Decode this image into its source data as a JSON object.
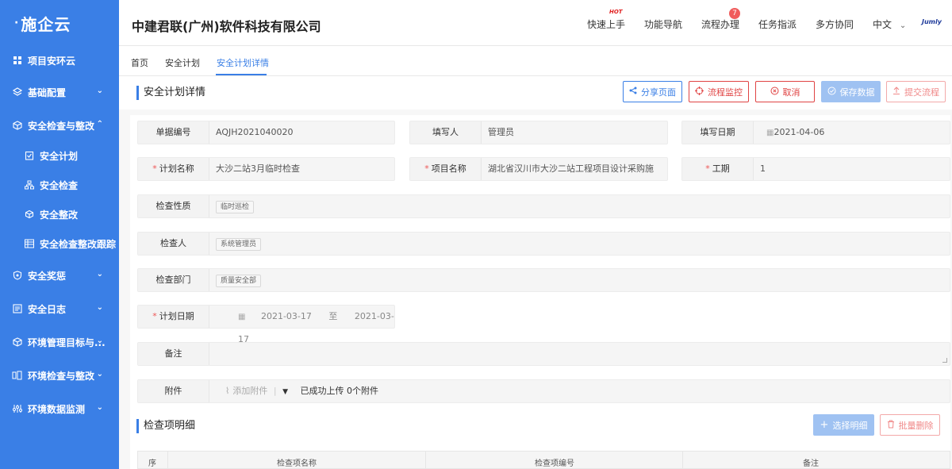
{
  "app": {
    "logo": "施企云"
  },
  "sidebar": {
    "items": [
      {
        "label": "项目安环云",
        "icon": "grid-icon"
      },
      {
        "label": "基础配置",
        "icon": "layers-icon"
      },
      {
        "label": "安全检查与整改",
        "icon": "cube-icon"
      },
      {
        "label": "安全计划",
        "icon": "clipboard-check-icon"
      },
      {
        "label": "安全检查",
        "icon": "sitemap-icon"
      },
      {
        "label": "安全整改",
        "icon": "cube-small-icon"
      },
      {
        "label": "安全检查整改跟踪",
        "icon": "table-icon"
      },
      {
        "label": "安全奖惩",
        "icon": "shield-icon"
      },
      {
        "label": "安全日志",
        "icon": "log-icon"
      },
      {
        "label": "环境管理目标与...",
        "icon": "cube-icon"
      },
      {
        "label": "环境检查与整改",
        "icon": "tools-icon"
      },
      {
        "label": "环境数据监测",
        "icon": "sliders-icon"
      }
    ]
  },
  "header": {
    "company": "中建君联(广州)软件科技有限公司",
    "nav": [
      "快速上手",
      "功能导航",
      "流程办理",
      "任务指派",
      "多方协同",
      "中文"
    ],
    "hot_label": "HOT",
    "badge_count": "7",
    "brand_mark": "Jumly"
  },
  "tabs": [
    "首页",
    "安全计划",
    "安全计划详情"
  ],
  "page": {
    "title": "安全计划详情",
    "buttons": {
      "share": "分享页面",
      "monitor": "流程监控",
      "cancel": "取消",
      "save": "保存数据",
      "submit": "提交流程"
    }
  },
  "colors": {
    "primary": "#3a7fe6",
    "danger": "#e04343",
    "disabled": "#9fc2f2"
  },
  "form": {
    "doc_no_label": "单据编号",
    "doc_no": "AQJH2021040020",
    "writer_label": "填写人",
    "writer": "管理员",
    "date_label": "填写日期",
    "date": "2021-04-06",
    "plan_name_label": "计划名称",
    "plan_name": "大沙二站3月临时检查",
    "project_label": "项目名称",
    "project": "湖北省汉川市大沙二站工程项目设计采购施",
    "period_label": "工期",
    "period": "1",
    "nature_label": "检查性质",
    "nature": "临时巡检",
    "inspector_label": "检查人",
    "inspector": "系统管理员",
    "dept_label": "检查部门",
    "dept": "质量安全部",
    "plan_date_label": "计划日期",
    "plan_start": "2021-03-17",
    "plan_to": "至",
    "plan_end": "2021-03-17",
    "remark_label": "备注",
    "attach_label": "附件",
    "attach_add": "添加附件",
    "attach_status": "已成功上传 0个附件"
  },
  "detail": {
    "title": "检查项明细",
    "select_button": "选择明细",
    "batch_delete_button": "批量删除",
    "columns": [
      "序",
      "检查项名称",
      "检查项编号",
      "备注"
    ]
  }
}
